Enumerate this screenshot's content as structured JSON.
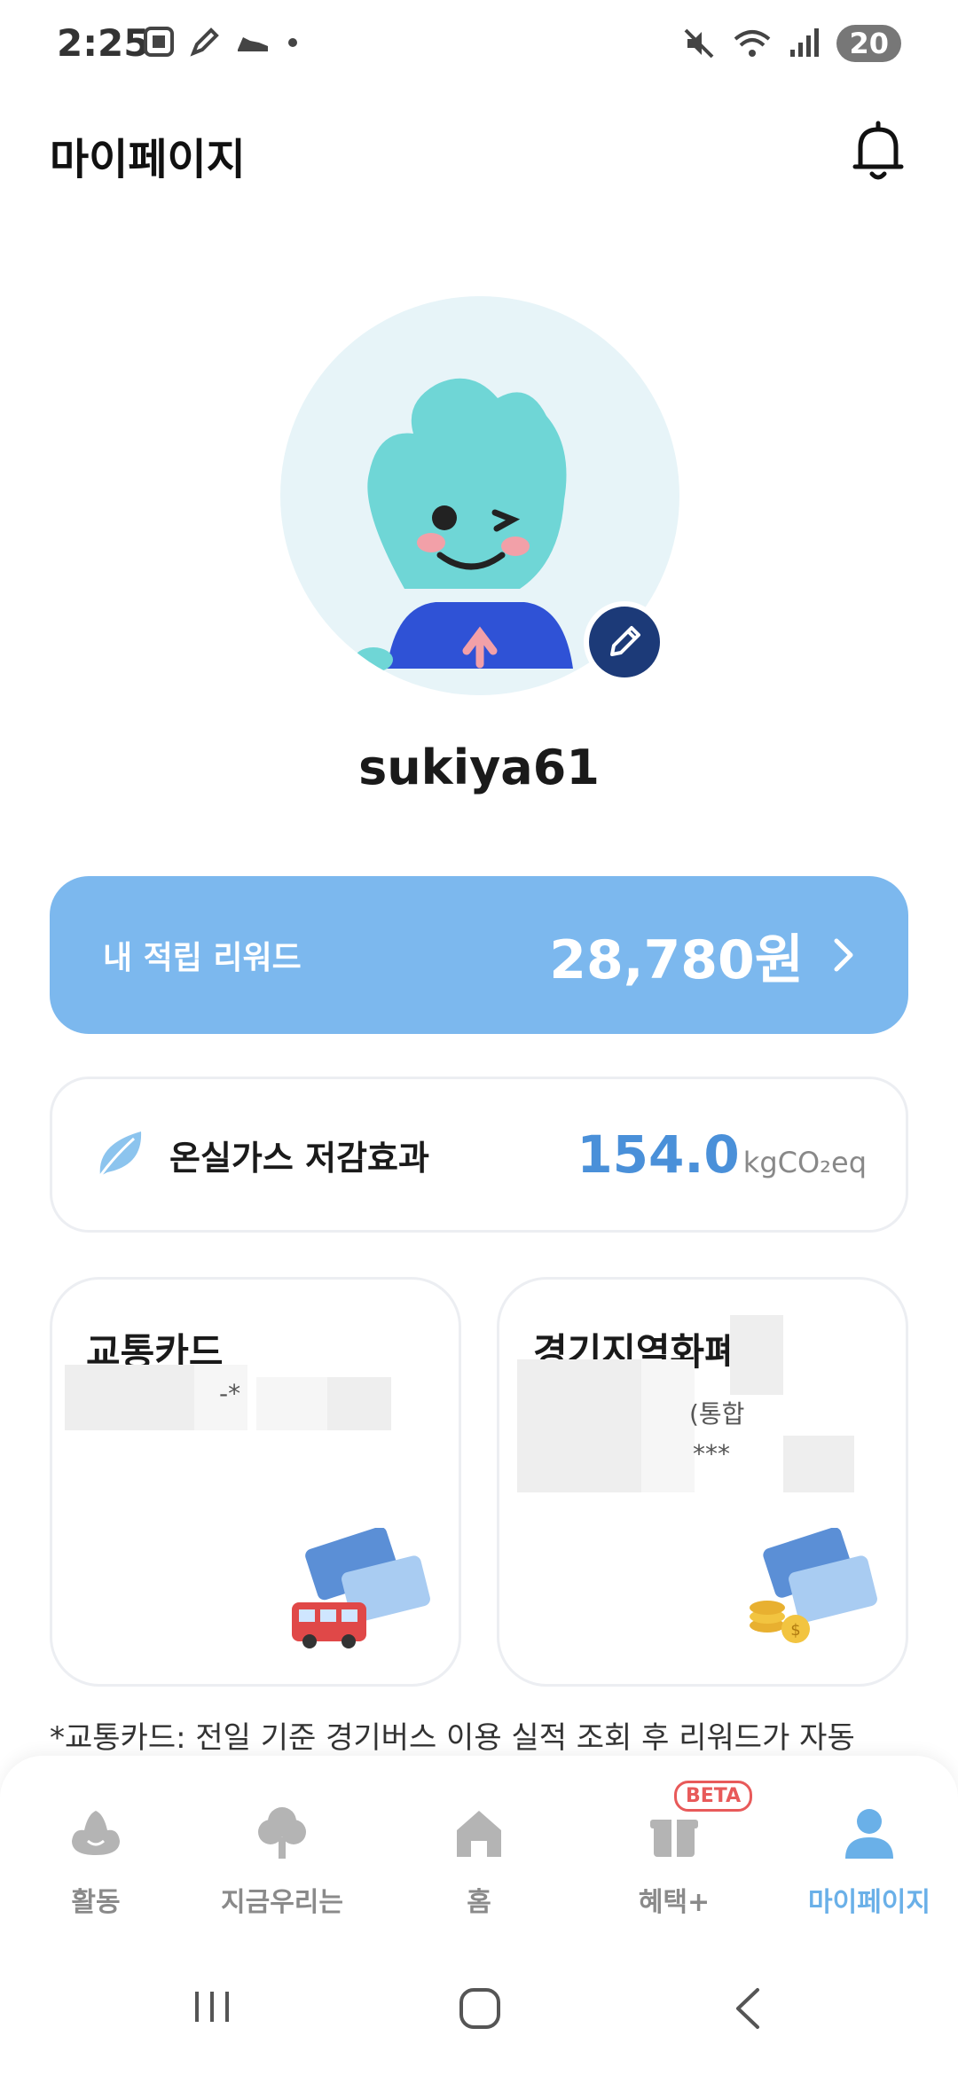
{
  "status_bar": {
    "time": "2:25",
    "battery": "20",
    "icons": [
      "screenshot-icon",
      "pen-icon",
      "shoe-icon",
      "dot-icon",
      "mute-icon",
      "wifi-icon",
      "signal-icon"
    ]
  },
  "header": {
    "title": "마이페이지"
  },
  "profile": {
    "username": "sukiya61"
  },
  "reward": {
    "label": "내 적립 리워드",
    "value": "28,780원"
  },
  "ghg": {
    "label": "온실가스 저감효과",
    "value": "154.0",
    "unit": "kgCO₂eq"
  },
  "cards": [
    {
      "title": "교통카드",
      "masked_text": "-*"
    },
    {
      "title": "경기지역화폐",
      "masked_text_1": "(통합",
      "masked_text_2": "***"
    }
  ],
  "footnote": "*교통카드: 전일 기준 경기버스 이용 실적 조회 후 리워드가 자동",
  "bottom_nav": {
    "items": [
      {
        "label": "활동",
        "icon": "activity-icon",
        "active": false
      },
      {
        "label": "지금우리는",
        "icon": "tree-icon",
        "active": false
      },
      {
        "label": "홈",
        "icon": "home-icon",
        "active": false
      },
      {
        "label": "혜택+",
        "icon": "gift-icon",
        "active": false,
        "badge": "BETA"
      },
      {
        "label": "마이페이지",
        "icon": "person-icon",
        "active": true
      }
    ]
  },
  "colors": {
    "accent": "#7cb8ee",
    "ghg_value": "#4a90d9",
    "active_nav": "#6ab0e8",
    "edit_button": "#1c3a78",
    "beta": "#e85a5a"
  }
}
